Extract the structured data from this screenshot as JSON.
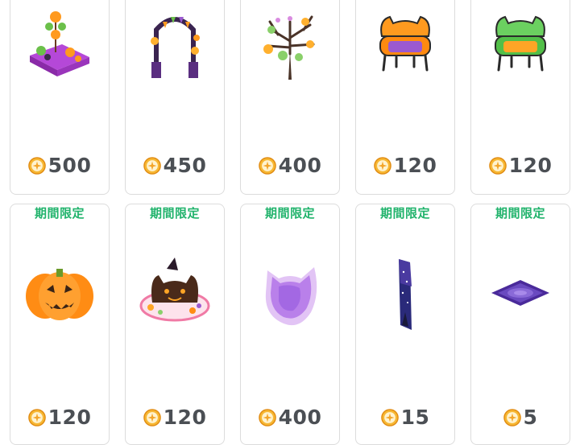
{
  "items_row1": [
    {
      "name": "halloween-party-table",
      "price": "500"
    },
    {
      "name": "halloween-lantern-arch",
      "price": "450"
    },
    {
      "name": "halloween-pumpkin-tree",
      "price": "400"
    },
    {
      "name": "orange-cat-sofa",
      "price": "120"
    },
    {
      "name": "green-cat-sofa",
      "price": "120"
    }
  ],
  "items_row2": [
    {
      "badge": "期間限定",
      "name": "jack-o-lantern",
      "price": "120"
    },
    {
      "badge": "期間限定",
      "name": "black-cat-cake",
      "price": "120"
    },
    {
      "badge": "期間限定",
      "name": "purple-ghost-cat",
      "price": "400"
    },
    {
      "badge": "期間限定",
      "name": "night-sky-wall-panel",
      "price": "15"
    },
    {
      "badge": "期間限定",
      "name": "purple-floor-tile",
      "price": "5"
    }
  ],
  "colors": {
    "badge": "#21b36c",
    "price": "#4b4f54",
    "coin": "#f3a52a"
  }
}
